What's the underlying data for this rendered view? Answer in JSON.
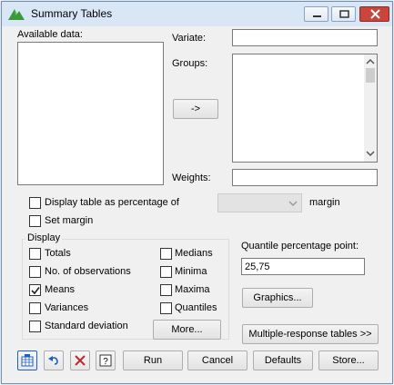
{
  "window": {
    "title": "Summary Tables",
    "controls": {
      "minimize": "minimize-icon",
      "maximize": "maximize-icon",
      "close": "close-icon"
    }
  },
  "available": {
    "label": "Available data:"
  },
  "variate": {
    "label": "Variate:",
    "value": ""
  },
  "groups": {
    "label": "Groups:",
    "value": ""
  },
  "arrow_button": "->",
  "weights": {
    "label": "Weights:",
    "value": ""
  },
  "percentage": {
    "label": "Display table as percentage of",
    "checked": false,
    "select_value": "",
    "suffix": "margin"
  },
  "set_margin": {
    "label": "Set margin",
    "checked": false
  },
  "display": {
    "title": "Display",
    "left": [
      {
        "label": "Totals",
        "checked": false
      },
      {
        "label": "No. of observations",
        "checked": false
      },
      {
        "label": "Means",
        "checked": true
      },
      {
        "label": "Variances",
        "checked": false
      },
      {
        "label": "Standard deviation",
        "checked": false
      }
    ],
    "right": [
      {
        "label": "Medians",
        "checked": false
      },
      {
        "label": "Minima",
        "checked": false
      },
      {
        "label": "Maxima",
        "checked": false
      },
      {
        "label": "Quantiles",
        "checked": false
      }
    ],
    "more_button": "More..."
  },
  "quantile": {
    "label": "Quantile percentage point:",
    "value": "25,75"
  },
  "graphics_button": "Graphics...",
  "multiresponse_button": "Multiple-response tables >>",
  "bottom": {
    "icons": [
      "spreadsheet-icon",
      "undo-icon",
      "clear-icon",
      "help-icon"
    ],
    "run": "Run",
    "cancel": "Cancel",
    "defaults": "Defaults",
    "store": "Store..."
  },
  "colors": {
    "titlebar": "#d8e6f5",
    "close": "#c9463d",
    "accent": "#1e5fbf"
  }
}
